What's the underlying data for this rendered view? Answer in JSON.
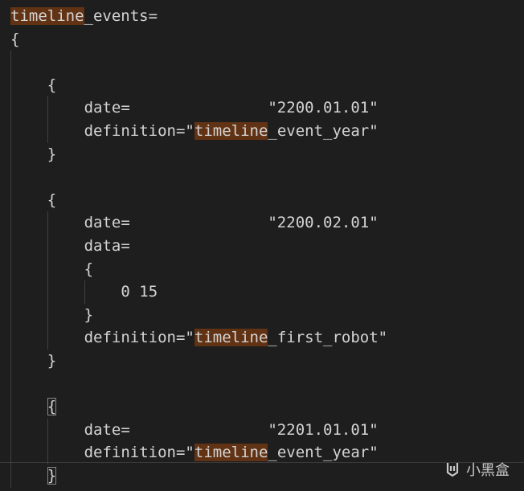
{
  "editor": {
    "lines": [
      {
        "row": 0,
        "indent": 0,
        "parts": [
          {
            "t": "timeline",
            "hl": true
          },
          {
            "t": "_events="
          }
        ]
      },
      {
        "row": 1,
        "indent": 0,
        "parts": [
          {
            "t": "{"
          }
        ]
      },
      {
        "row": 3,
        "indent": 4,
        "parts": [
          {
            "t": "{"
          }
        ]
      },
      {
        "row": 4,
        "indent": 8,
        "parts": [
          {
            "t": "date=               \"2200.01.01\""
          }
        ]
      },
      {
        "row": 5,
        "indent": 8,
        "parts": [
          {
            "t": "definition=\""
          },
          {
            "t": "timeline",
            "hl": true
          },
          {
            "t": "_event_year\""
          }
        ]
      },
      {
        "row": 6,
        "indent": 4,
        "parts": [
          {
            "t": "}"
          }
        ]
      },
      {
        "row": 8,
        "indent": 4,
        "parts": [
          {
            "t": "{"
          }
        ]
      },
      {
        "row": 9,
        "indent": 8,
        "parts": [
          {
            "t": "date=               \"2200.02.01\""
          }
        ]
      },
      {
        "row": 10,
        "indent": 8,
        "parts": [
          {
            "t": "data="
          }
        ]
      },
      {
        "row": 11,
        "indent": 8,
        "parts": [
          {
            "t": "{"
          }
        ]
      },
      {
        "row": 12,
        "indent": 12,
        "parts": [
          {
            "t": "0 15"
          }
        ]
      },
      {
        "row": 13,
        "indent": 8,
        "parts": [
          {
            "t": "}"
          }
        ]
      },
      {
        "row": 14,
        "indent": 8,
        "parts": [
          {
            "t": "definition=\""
          },
          {
            "t": "timeline",
            "hl": true
          },
          {
            "t": "_first_robot\""
          }
        ]
      },
      {
        "row": 15,
        "indent": 4,
        "parts": [
          {
            "t": "}"
          }
        ]
      },
      {
        "row": 17,
        "indent": 4,
        "parts": [
          {
            "t": "{",
            "match": true
          }
        ]
      },
      {
        "row": 18,
        "indent": 8,
        "parts": [
          {
            "t": "date=               \"2201.01.01\""
          }
        ]
      },
      {
        "row": 19,
        "indent": 8,
        "parts": [
          {
            "t": "definition=\""
          },
          {
            "t": "timeline",
            "hl": true
          },
          {
            "t": "_event_year\""
          }
        ]
      },
      {
        "row": 20,
        "indent": 4,
        "parts": [
          {
            "t": "}",
            "match": true
          }
        ]
      }
    ]
  },
  "watermark": {
    "text": "小黑盒",
    "icon": "xiaoheihe-logo-icon"
  },
  "colors": {
    "background": "#1e1e1e",
    "text": "#d4d4d4",
    "highlight": "#613214"
  }
}
